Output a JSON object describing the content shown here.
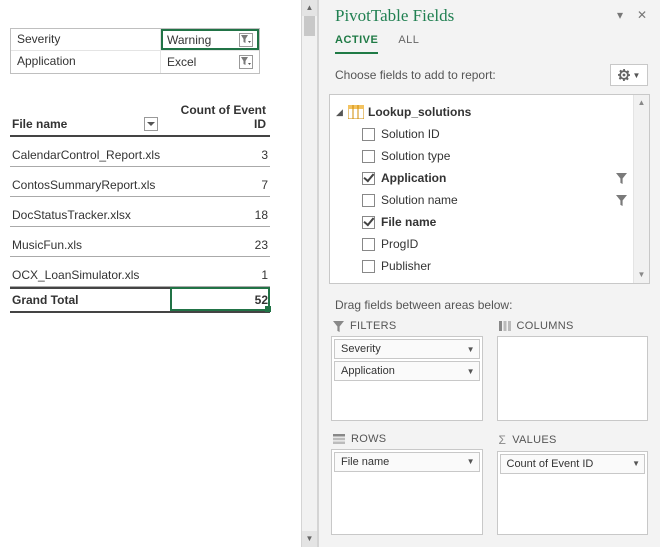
{
  "filters": {
    "rows": [
      {
        "label": "Severity",
        "value": "Warning"
      },
      {
        "label": "Application",
        "value": "Excel"
      }
    ]
  },
  "pivot": {
    "row_header": "File name",
    "value_header": "Count of Event ID",
    "rows": [
      {
        "name": "CalendarControl_Report.xls",
        "value": "3"
      },
      {
        "name": "ContosSummaryReport.xls",
        "value": "7"
      },
      {
        "name": "DocStatusTracker.xlsx",
        "value": "18"
      },
      {
        "name": "MusicFun.xls",
        "value": "23"
      },
      {
        "name": "OCX_LoanSimulator.xls",
        "value": "1"
      }
    ],
    "total_label": "Grand Total",
    "total_value": "52"
  },
  "panel": {
    "title": "PivotTable Fields",
    "tab_active": "ACTIVE",
    "tab_all": "ALL",
    "choose_text": "Choose fields to add to report:",
    "source": "Lookup_solutions",
    "fields": [
      {
        "label": "Solution ID",
        "checked": false,
        "filterable": false
      },
      {
        "label": "Solution type",
        "checked": false,
        "filterable": false
      },
      {
        "label": "Application",
        "checked": true,
        "filterable": true
      },
      {
        "label": "Solution name",
        "checked": false,
        "filterable": true
      },
      {
        "label": "File name",
        "checked": true,
        "filterable": false
      },
      {
        "label": "ProgID",
        "checked": false,
        "filterable": false
      },
      {
        "label": "Publisher",
        "checked": false,
        "filterable": false
      }
    ],
    "drag_caption": "Drag fields between areas below:",
    "areas": {
      "filters_label": "FILTERS",
      "columns_label": "COLUMNS",
      "rows_label": "ROWS",
      "values_label": "VALUES",
      "filters_items": [
        "Severity",
        "Application"
      ],
      "rows_items": [
        "File name"
      ],
      "values_items": [
        "Count of Event ID"
      ]
    }
  }
}
